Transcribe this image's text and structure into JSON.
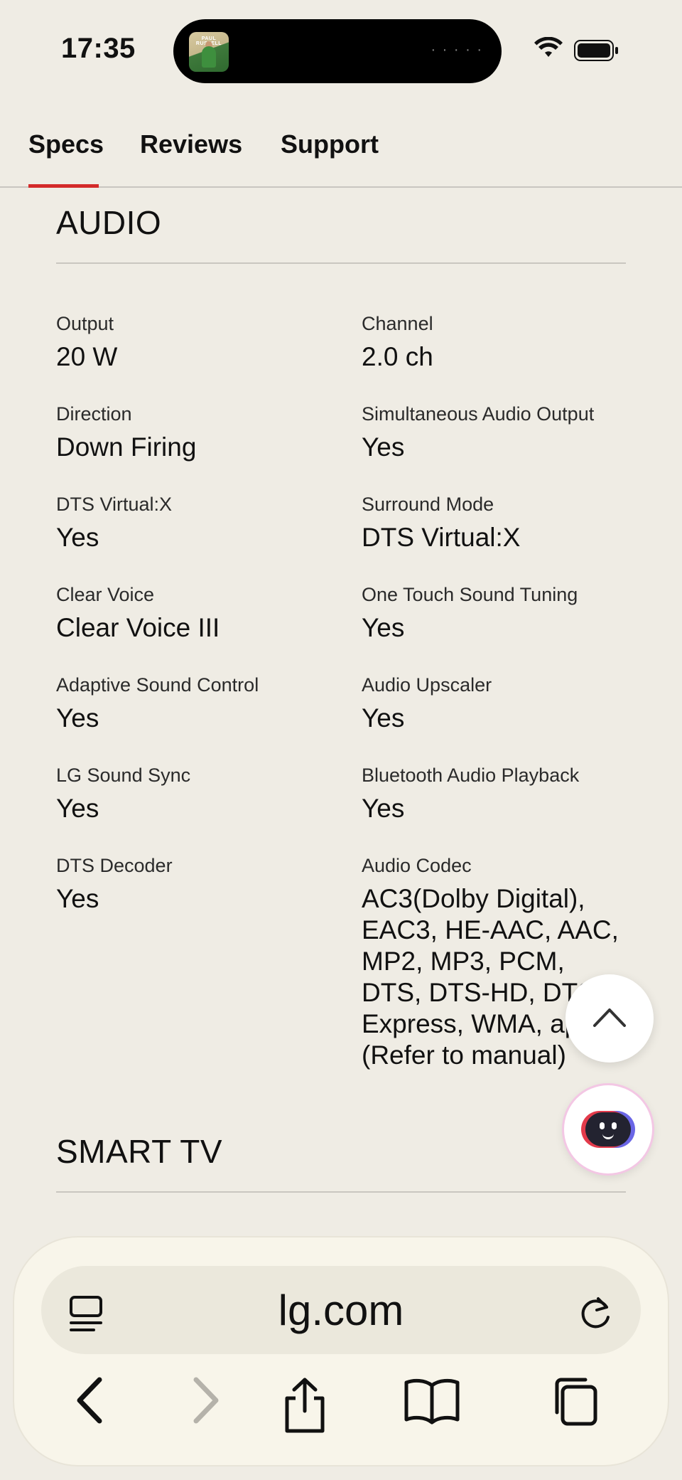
{
  "status_bar": {
    "time": "17:35",
    "album_art_text": "PAUL RUSSELL",
    "icons": [
      "wifi-icon",
      "battery-icon"
    ]
  },
  "tabs": [
    {
      "label": "Specs",
      "active": true
    },
    {
      "label": "Reviews",
      "active": false
    },
    {
      "label": "Support",
      "active": false
    }
  ],
  "audio": {
    "title": "AUDIO",
    "specs": [
      {
        "label": "Output",
        "value": "20 W"
      },
      {
        "label": "Channel",
        "value": "2.0 ch"
      },
      {
        "label": "Direction",
        "value": "Down Firing"
      },
      {
        "label": "Simultaneous Audio Output",
        "value": "Yes"
      },
      {
        "label": "DTS Virtual:X",
        "value": "Yes"
      },
      {
        "label": "Surround Mode",
        "value": "DTS Virtual:X"
      },
      {
        "label": "Clear Voice",
        "value": "Clear Voice III"
      },
      {
        "label": "One Touch Sound Tuning",
        "value": "Yes"
      },
      {
        "label": "Adaptive Sound Control",
        "value": "Yes"
      },
      {
        "label": "Audio Upscaler",
        "value": "Yes"
      },
      {
        "label": "LG Sound Sync",
        "value": "Yes"
      },
      {
        "label": "Bluetooth Audio Playback",
        "value": "Yes"
      },
      {
        "label": "DTS Decoder",
        "value": "Yes"
      },
      {
        "label": "Audio Codec",
        "value": "AC3(Dolby Digital), EAC3, HE-AAC, AAC, MP2, MP3, PCM, DTS, DTS-HD, DTS Express, WMA, apt-X (Refer to manual)"
      }
    ]
  },
  "smart_tv": {
    "title": "SMART TV"
  },
  "browser": {
    "url": "lg.com",
    "icons": [
      "reader-icon",
      "reload-icon",
      "back-icon",
      "forward-icon",
      "share-icon",
      "bookmarks-icon",
      "tabs-icon"
    ]
  },
  "colors": {
    "background": "#efece4",
    "accent": "#d42a2a",
    "browser_bar": "#f8f5ea"
  }
}
